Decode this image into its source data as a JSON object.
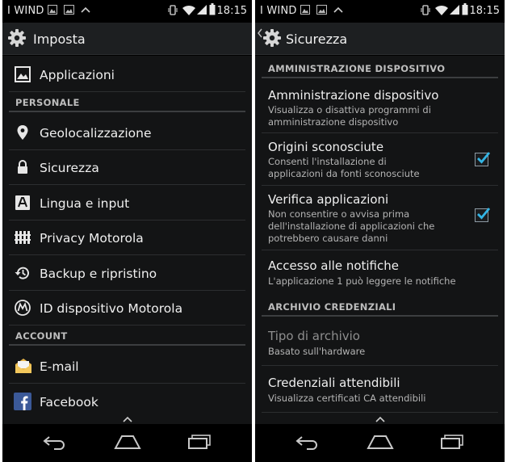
{
  "colors": {
    "accent": "#33b5e5",
    "background": "#131415",
    "action_bar": "#1d1f21",
    "divider": "#2c2e30"
  },
  "status_bar": {
    "carrier": "I WIND",
    "time": "18:15"
  },
  "left_screen": {
    "title": "Imposta",
    "items": [
      {
        "label": "Applicazioni",
        "icon": "applications-image-icon"
      },
      {
        "section": "PERSONALE"
      },
      {
        "label": "Geolocalizzazione",
        "icon": "location-pin-icon"
      },
      {
        "label": "Sicurezza",
        "icon": "lock-icon"
      },
      {
        "label": "Lingua e input",
        "icon": "keyboard-a-icon"
      },
      {
        "label": "Privacy Motorola",
        "icon": "privacy-fence-icon"
      },
      {
        "label": "Backup e ripristino",
        "icon": "backup-restore-icon"
      },
      {
        "label": "ID dispositivo Motorola",
        "icon": "motorola-logo-icon"
      },
      {
        "section": "ACCOUNT"
      },
      {
        "label": "E-mail",
        "icon": "email-envelope-icon"
      },
      {
        "label": "Facebook",
        "icon": "facebook-icon"
      }
    ]
  },
  "right_screen": {
    "title": "Sicurezza",
    "section_admin": "AMMINISTRAZIONE DISPOSITIVO",
    "device_admin": {
      "title": "Amministrazione dispositivo",
      "subtitle": "Visualizza o disattiva programmi di amministrazione dispositivo"
    },
    "unknown_sources": {
      "title": "Origini sconosciute",
      "subtitle": "Consenti l'installazione di applicazioni da fonti sconosciute",
      "checked": true
    },
    "verify_apps": {
      "title": "Verifica applicazioni",
      "subtitle": "Non consentire o avvisa prima dell'installazione di applicazioni che potrebbero causare danni",
      "checked": true
    },
    "notification_access": {
      "title": "Accesso alle notifiche",
      "subtitle": "L'applicazione 1 può leggere le notifiche"
    },
    "section_credentials": "ARCHIVIO CREDENZIALI",
    "storage_type": {
      "title": "Tipo di archivio",
      "subtitle": "Basato sull'hardware"
    },
    "trusted_credentials": {
      "title": "Credenziali attendibili",
      "subtitle": "Visualizza certificati CA attendibili"
    }
  }
}
